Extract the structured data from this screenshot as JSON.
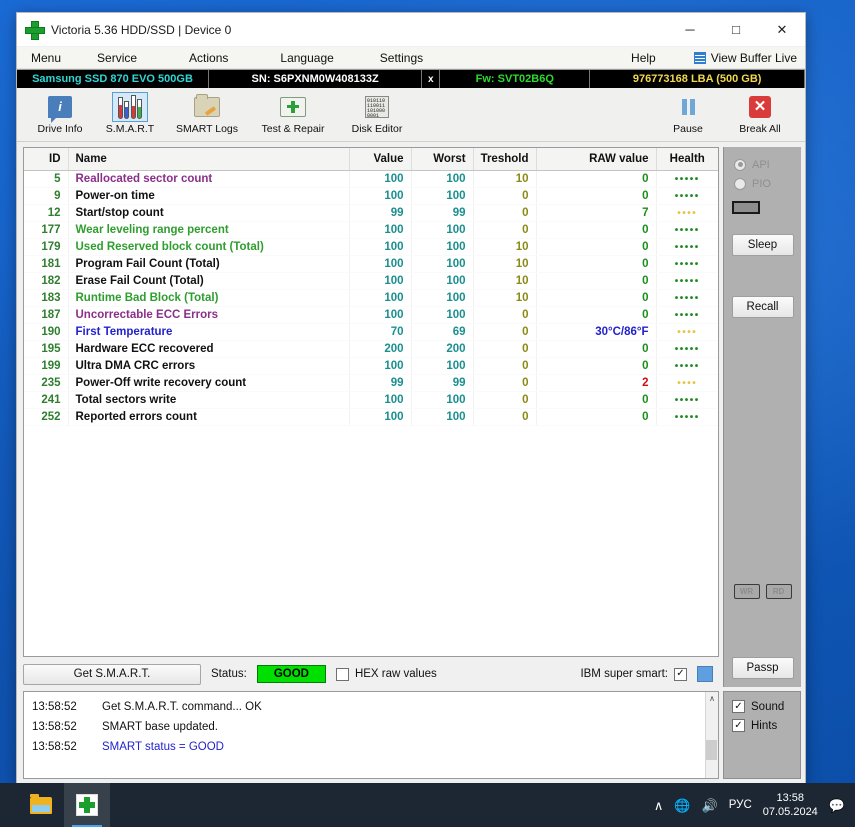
{
  "window": {
    "title": "Victoria 5.36 HDD/SSD | Device 0",
    "icon": "victoria-cross-icon",
    "minimize": "─",
    "maximize": "□",
    "close": "✕"
  },
  "menubar": {
    "items": [
      {
        "label": "Menu"
      },
      {
        "label": "Service"
      },
      {
        "label": "Actions"
      },
      {
        "label": "Language"
      },
      {
        "label": "Settings"
      },
      {
        "label": "Help"
      }
    ],
    "view_buffer_live": "View Buffer Live"
  },
  "device": {
    "model": "Samsung SSD 870 EVO 500GB",
    "serial": "SN: S6PXNM0W408133Z",
    "x_button": "x",
    "firmware": "Fw: SVT02B6Q",
    "capacity": "976773168 LBA (500 GB)",
    "colors": {
      "model": "#2fd6d6",
      "serial": "#ffffff",
      "firmware": "#2bdb2b",
      "capacity": "#f2d94e"
    }
  },
  "toolbar": {
    "buttons": [
      {
        "label": "Drive Info",
        "icon": "info-icon",
        "active": false
      },
      {
        "label": "S.M.A.R.T",
        "icon": "test-tubes-icon",
        "active": true
      },
      {
        "label": "SMART Logs",
        "icon": "folder-icon",
        "active": false
      },
      {
        "label": "Test & Repair",
        "icon": "first-aid-kit-icon",
        "active": false
      },
      {
        "label": "Disk Editor",
        "icon": "binary-document-icon",
        "active": false
      }
    ],
    "right_buttons": [
      {
        "label": "Pause",
        "icon": "pause-icon"
      },
      {
        "label": "Break All",
        "icon": "red-x-icon"
      }
    ],
    "hex_icon_text": "010110\n110011\n101000\n0001"
  },
  "table": {
    "headers": [
      "ID",
      "Name",
      "Value",
      "Worst",
      "Treshold",
      "RAW value",
      "Health"
    ],
    "rows": [
      {
        "id": "5",
        "name": "Reallocated sector count",
        "name_color": "purple",
        "value": "100",
        "worst": "100",
        "threshold": "10",
        "raw": "0",
        "raw_color": "green",
        "health": "•••••",
        "health_state": "good"
      },
      {
        "id": "9",
        "name": "Power-on time",
        "name_color": "black",
        "value": "100",
        "worst": "100",
        "threshold": "0",
        "raw": "0",
        "raw_color": "green",
        "health": "•••••",
        "health_state": "good"
      },
      {
        "id": "12",
        "name": "Start/stop count",
        "name_color": "black",
        "value": "99",
        "worst": "99",
        "threshold": "0",
        "raw": "7",
        "raw_color": "green",
        "health": "••••",
        "health_state": "warn"
      },
      {
        "id": "177",
        "name": "Wear leveling range percent",
        "name_color": "green",
        "value": "100",
        "worst": "100",
        "threshold": "0",
        "raw": "0",
        "raw_color": "green",
        "health": "•••••",
        "health_state": "good"
      },
      {
        "id": "179",
        "name": "Used Reserved block count (Total)",
        "name_color": "green",
        "value": "100",
        "worst": "100",
        "threshold": "10",
        "raw": "0",
        "raw_color": "green",
        "health": "•••••",
        "health_state": "good"
      },
      {
        "id": "181",
        "name": "Program Fail Count (Total)",
        "name_color": "black",
        "value": "100",
        "worst": "100",
        "threshold": "10",
        "raw": "0",
        "raw_color": "green",
        "health": "•••••",
        "health_state": "good"
      },
      {
        "id": "182",
        "name": "Erase Fail Count (Total)",
        "name_color": "black",
        "value": "100",
        "worst": "100",
        "threshold": "10",
        "raw": "0",
        "raw_color": "green",
        "health": "•••••",
        "health_state": "good"
      },
      {
        "id": "183",
        "name": "Runtime Bad Block (Total)",
        "name_color": "green",
        "value": "100",
        "worst": "100",
        "threshold": "10",
        "raw": "0",
        "raw_color": "green",
        "health": "•••••",
        "health_state": "good"
      },
      {
        "id": "187",
        "name": "Uncorrectable ECC Errors",
        "name_color": "purple",
        "value": "100",
        "worst": "100",
        "threshold": "0",
        "raw": "0",
        "raw_color": "green",
        "health": "•••••",
        "health_state": "good"
      },
      {
        "id": "190",
        "name": "First Temperature",
        "name_color": "blue",
        "value": "70",
        "worst": "69",
        "threshold": "0",
        "raw": "30°C/86°F",
        "raw_color": "blue",
        "health": "••••",
        "health_state": "warn"
      },
      {
        "id": "195",
        "name": "Hardware ECC recovered",
        "name_color": "black",
        "value": "200",
        "worst": "200",
        "threshold": "0",
        "raw": "0",
        "raw_color": "green",
        "health": "•••••",
        "health_state": "good"
      },
      {
        "id": "199",
        "name": "Ultra DMA CRC errors",
        "name_color": "black",
        "value": "100",
        "worst": "100",
        "threshold": "0",
        "raw": "0",
        "raw_color": "green",
        "health": "•••••",
        "health_state": "good"
      },
      {
        "id": "235",
        "name": "Power-Off write recovery count",
        "name_color": "black",
        "value": "99",
        "worst": "99",
        "threshold": "0",
        "raw": "2",
        "raw_color": "red",
        "health": "••••",
        "health_state": "warn"
      },
      {
        "id": "241",
        "name": "Total sectors write",
        "name_color": "black",
        "value": "100",
        "worst": "100",
        "threshold": "0",
        "raw": "0",
        "raw_color": "green",
        "health": "•••••",
        "health_state": "good"
      },
      {
        "id": "252",
        "name": "Reported errors count",
        "name_color": "black",
        "value": "100",
        "worst": "100",
        "threshold": "0",
        "raw": "0",
        "raw_color": "green",
        "health": "•••••",
        "health_state": "good"
      }
    ]
  },
  "statusbar": {
    "get_smart_label": "Get S.M.A.R.T.",
    "status_label": "Status:",
    "status_value": "GOOD",
    "status_color": "#00e000",
    "hex_raw_label": "HEX raw values",
    "hex_raw_checked": false,
    "ibm_label": "IBM super smart:",
    "ibm_checked": true,
    "check_glyph": "✓"
  },
  "sidebar": {
    "api_label": "API",
    "pio_label": "PIO",
    "api_selected": true,
    "pio_selected": false,
    "sleep_label": "Sleep",
    "recall_label": "Recall",
    "wr_label": "WR",
    "rd_label": "RD",
    "passp_label": "Passp"
  },
  "log": {
    "lines": [
      {
        "time": "13:58:52",
        "message": "Get S.M.A.R.T. command... OK",
        "color": "black"
      },
      {
        "time": "13:58:52",
        "message": "SMART base updated.",
        "color": "black"
      },
      {
        "time": "13:58:52",
        "message": "SMART status = GOOD",
        "color": "blue"
      }
    ],
    "scroll_up": "∧",
    "sound_label": "Sound",
    "sound_checked": true,
    "hints_label": "Hints",
    "hints_checked": true
  },
  "taskbar": {
    "apps": [
      {
        "name": "file-explorer",
        "active": false
      },
      {
        "name": "victoria",
        "active": true
      }
    ],
    "tray": {
      "chevron": "∧",
      "network": "⊕",
      "volume": "⏵",
      "language": "РУС",
      "time": "13:58",
      "date": "07.05.2024",
      "notification": "▭"
    }
  }
}
